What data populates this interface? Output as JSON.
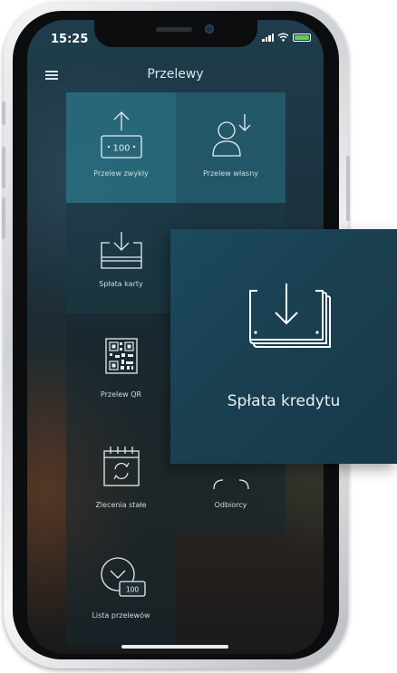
{
  "status_bar": {
    "time": "15:25"
  },
  "header": {
    "title": "Przelewy",
    "menu_icon": "hamburger-icon"
  },
  "tiles": [
    {
      "label": "Przelew zwykły",
      "icon": "transfer-out-icon"
    },
    {
      "label": "Przelew własny",
      "icon": "person-transfer-icon"
    },
    {
      "label": "Spłata karty",
      "icon": "card-payment-icon"
    },
    {
      "label": "",
      "icon": "hidden"
    },
    {
      "label": "Przelew QR",
      "icon": "qr-code-icon"
    },
    {
      "label": "",
      "icon": "hidden"
    },
    {
      "label": "Zlecenia stałe",
      "icon": "calendar-recurring-icon"
    },
    {
      "label": "Odbiorcy",
      "icon": "recipients-icon"
    },
    {
      "label": "Lista przelewów",
      "icon": "clock-money-icon"
    }
  ],
  "callout": {
    "label": "Spłata kredytu",
    "icon": "loan-repayment-icon"
  },
  "money_badge": "100",
  "colors": {
    "accent": "#2a6b7d",
    "callout": "#1b4356",
    "battery": "#59d14a"
  }
}
